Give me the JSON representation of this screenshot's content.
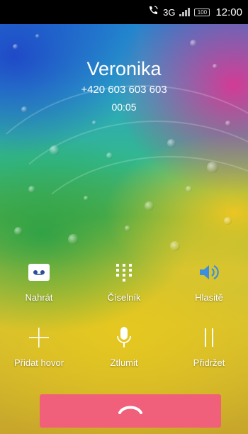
{
  "status_bar": {
    "network": "3G",
    "battery": "100",
    "time": "12:00"
  },
  "call": {
    "name": "Veronika",
    "number": "+420 603 603 603",
    "duration": "00:05"
  },
  "actions": {
    "record": "Nahrát",
    "keypad": "Číselník",
    "speaker": "Hlasitě",
    "add_call": "Přidat hovor",
    "mute": "Ztlumit",
    "hold": "Přidržet"
  },
  "colors": {
    "end_call": "#f0607a",
    "speaker_active": "#3b8fe0"
  }
}
